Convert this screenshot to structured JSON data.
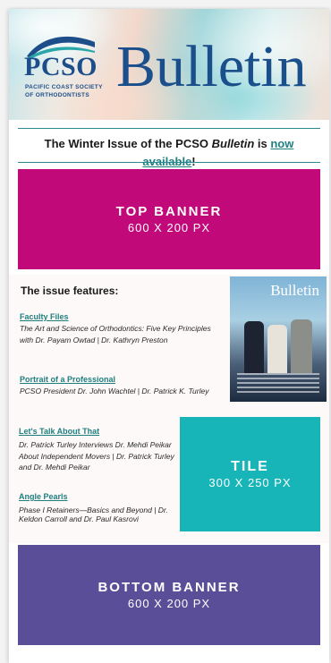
{
  "header": {
    "org_short": "PCSO",
    "org_full_line1": "PACIFIC COAST SOCIETY",
    "org_full_line2": "OF ORTHODONTISTS",
    "publication": "Bulletin"
  },
  "announcement": {
    "prefix": "The Winter Issue of the PCSO ",
    "emphasis": "Bulletin",
    "middle": " is ",
    "link_text": "now available",
    "suffix": "!"
  },
  "top_banner": {
    "title": "TOP BANNER",
    "size": "600 X 200 PX"
  },
  "issue": {
    "heading": "The issue features:",
    "cover_title": "Bulletin",
    "articles": [
      {
        "title": "Faculty Files",
        "description": "The Art and Science of Orthodontics: Five Key Principles with Dr. Payam Owtad | Dr. Kathryn Preston"
      },
      {
        "title": "Portrait of a Professional",
        "description": "PCSO President Dr. John Wachtel | Dr. Patrick K. Turley"
      },
      {
        "title": "Let's Talk About That",
        "description": "Dr. Patrick Turley Interviews Dr. Mehdi Peikar About Independent Movers | Dr. Patrick Turley and Dr. Mehdi Peikar"
      },
      {
        "title": "Angle Pearls",
        "description": "Phase I Retainers—Basics and Beyond | Dr. Keldon Carroll and Dr. Paul Kasrovi"
      }
    ]
  },
  "tile": {
    "title": "TILE",
    "size": "300 X 250 PX"
  },
  "bottom_banner": {
    "title": "BOTTOM BANNER",
    "size": "600 X 200 PX"
  },
  "colors": {
    "brand_blue": "#1a4f8c",
    "link_teal": "#1f7f7f",
    "top_banner": "#c2097a",
    "tile": "#17b4b8",
    "bottom_banner": "#5a4e98"
  }
}
